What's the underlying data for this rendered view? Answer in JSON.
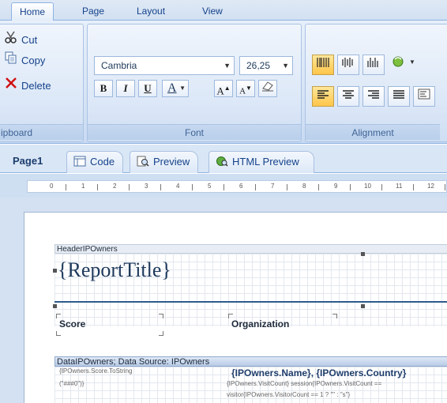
{
  "ribbon": {
    "tabs": [
      "Home",
      "Page",
      "Layout",
      "View"
    ],
    "clipboard": {
      "cut": "Cut",
      "copy": "Copy",
      "delete": "Delete",
      "group_label": "ipboard"
    },
    "font": {
      "family": "Cambria",
      "size": "26,25",
      "bold": "B",
      "italic": "I",
      "underline": "U",
      "color": "A",
      "grow": "A",
      "shrink": "A",
      "group_label": "Font"
    },
    "alignment": {
      "group_label": "Alignment"
    }
  },
  "doc_tabs": [
    "Page1",
    "Code",
    "Preview",
    "HTML Preview"
  ],
  "ruler": [
    "0",
    "1",
    "2",
    "3",
    "4",
    "5",
    "6",
    "7",
    "8",
    "9",
    "10",
    "11",
    "12"
  ],
  "report": {
    "header_band": "HeaderIPOwners",
    "title": "{ReportTitle}",
    "col_score": "Score",
    "col_org": "Organization",
    "data_band": "DataIPOwners; Data Source: IPOwners",
    "score_expr_1": "{IPOwners.Score.ToString",
    "score_expr_2": "(\"###0\")}",
    "name_expr": "{IPOwners.Name}, {IPOwners.Country}",
    "visit_expr_1": "{IPOwners.VisitCount} session{IPOwners.VisitCount ==",
    "visit_expr_2": "visitor{IPOwners.VisitorCount == 1 ? \"\" : \"s\"}"
  }
}
